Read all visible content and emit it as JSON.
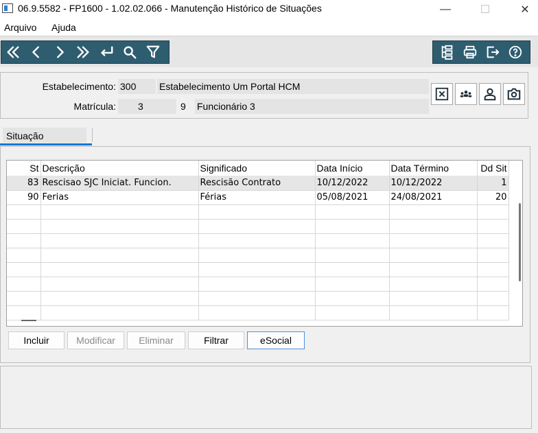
{
  "window": {
    "title": "06.9.5582 - FP1600 - 1.02.02.066 - Manutenção Histórico de Situações",
    "minimize_glyph": "—",
    "maximize_glyph": "☐",
    "close_glyph": "✕"
  },
  "menu": {
    "items": [
      "Arquivo",
      "Ajuda"
    ]
  },
  "toolbar": {
    "nav_buttons": [
      {
        "icon": "first-record-icon",
        "glyph": "«"
      },
      {
        "icon": "previous-record-icon",
        "glyph": "‹"
      },
      {
        "icon": "next-record-icon",
        "glyph": "›"
      },
      {
        "icon": "last-record-icon",
        "glyph": "»"
      },
      {
        "icon": "goto-icon",
        "glyph": "↵"
      },
      {
        "icon": "search-icon",
        "glyph": ""
      },
      {
        "icon": "filter-icon",
        "glyph": ""
      }
    ],
    "right_buttons": [
      "tree-view-icon",
      "print-icon",
      "exit-icon",
      "help-icon"
    ]
  },
  "header": {
    "estabelecimento_label": "Estabelecimento:",
    "estabelecimento_code": "300",
    "estabelecimento_name": "Estabelecimento Um Portal HCM",
    "matricula_label": "Matrícula:",
    "matricula_number": "3",
    "matricula_digit": "9",
    "funcionario_name": "Funcionário 3",
    "side_buttons": [
      "cancel-icon",
      "group-icon",
      "person-icon",
      "camera-icon"
    ]
  },
  "tabs": [
    {
      "label": "Situação"
    }
  ],
  "grid": {
    "columns": [
      "St",
      "Descrição",
      "Significado",
      "Data Início",
      "Data Término",
      "Dd Sit"
    ],
    "rows": [
      {
        "st": "83",
        "descricao": "Rescisao SJC Iniciat. Funcion.",
        "significado": "Rescisão Contrato",
        "inicio": "10/12/2022",
        "termino": "10/12/2022",
        "dd": "1"
      },
      {
        "st": "90",
        "descricao": "Ferias",
        "significado": "Férias",
        "inicio": "05/08/2021",
        "termino": "24/08/2021",
        "dd": "20"
      }
    ],
    "empty_rows": 8
  },
  "actions": {
    "incluir": "Incluir",
    "modificar": "Modificar",
    "eliminar": "Eliminar",
    "filtrar": "Filtrar",
    "esocial": "eSocial"
  },
  "colors": {
    "toolbar_bg": "#2f5d70",
    "tab_accent": "#0078d7",
    "selected_row": "#e6e6e6"
  }
}
